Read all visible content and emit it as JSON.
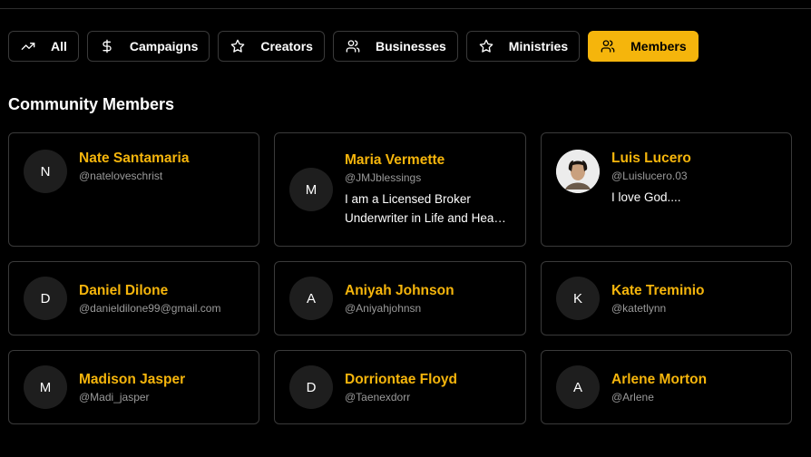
{
  "tabs": [
    {
      "label": "All",
      "icon": "trending-up-icon",
      "active": false
    },
    {
      "label": "Campaigns",
      "icon": "dollar-icon",
      "active": false
    },
    {
      "label": "Creators",
      "icon": "star-icon",
      "active": false
    },
    {
      "label": "Businesses",
      "icon": "users-icon",
      "active": false
    },
    {
      "label": "Ministries",
      "icon": "star-icon",
      "active": false
    },
    {
      "label": "Members",
      "icon": "users-icon",
      "active": true
    }
  ],
  "colors": {
    "accent": "#f5b50c",
    "background": "#000000",
    "border": "#3a3a3a",
    "avatar_bg": "#1e1e1e",
    "handle": "#9a9a9a"
  },
  "section_title": "Community Members",
  "members": [
    {
      "initial": "N",
      "name": "Nate Santamaria",
      "handle": "@nateloveschrist",
      "bio": ""
    },
    {
      "initial": "M",
      "name": "Maria Vermette",
      "handle": "@JMJblessings",
      "bio": "I am a Licensed Broker Underwriter in Life and Health Insurance"
    },
    {
      "initial": "",
      "name": "Luis Lucero",
      "handle": "@Luislucero.03",
      "bio": "I love God....",
      "photo": true
    },
    {
      "initial": "D",
      "name": "Daniel Dilone",
      "handle": "@danieldilone99@gmail.com",
      "bio": ""
    },
    {
      "initial": "A",
      "name": "Aniyah Johnson",
      "handle": "@Aniyahjohnsn",
      "bio": ""
    },
    {
      "initial": "K",
      "name": "Kate Treminio",
      "handle": "@katetlynn",
      "bio": ""
    },
    {
      "initial": "M",
      "name": "Madison Jasper",
      "handle": "@Madi_jasper",
      "bio": ""
    },
    {
      "initial": "D",
      "name": "Dorriontae Floyd",
      "handle": "@Taenexdorr",
      "bio": ""
    },
    {
      "initial": "A",
      "name": "Arlene Morton",
      "handle": "@Arlene",
      "bio": ""
    }
  ]
}
